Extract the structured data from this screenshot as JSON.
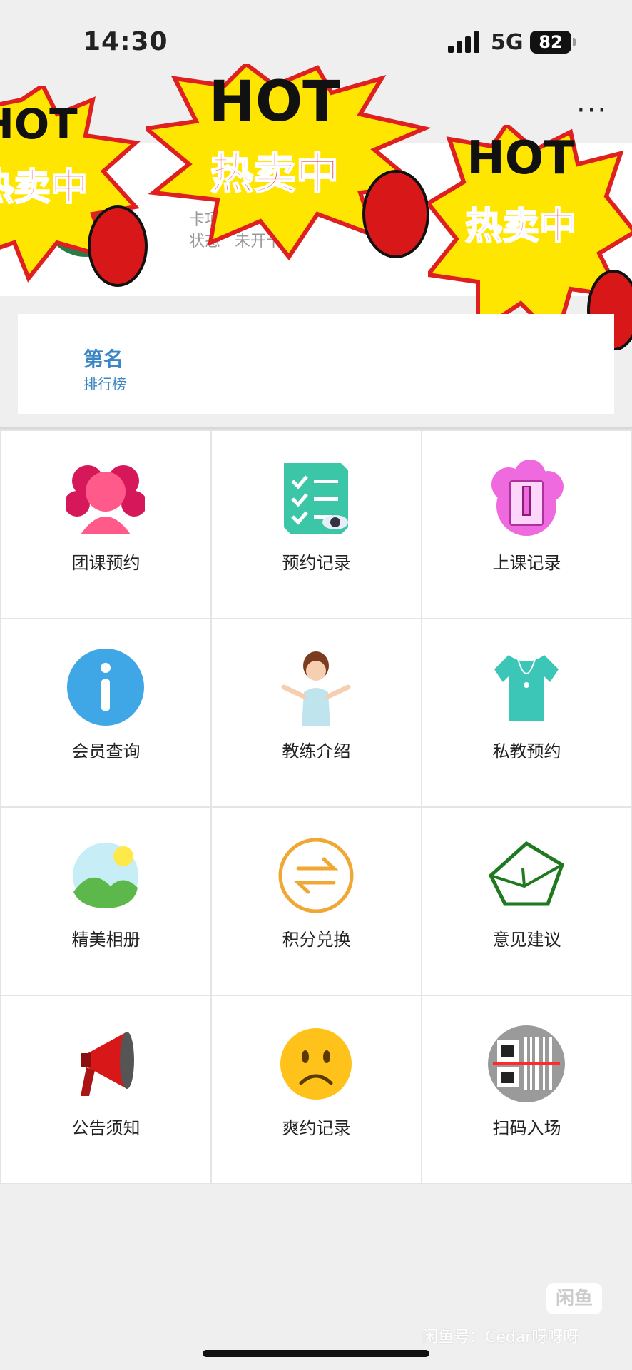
{
  "status_bar": {
    "time": "14:30",
    "network": "5G",
    "battery": "82"
  },
  "card": {
    "row1": "卡项",
    "status_label": "状态",
    "status_value": "未开卡"
  },
  "stickers": {
    "hot": "HOT",
    "sub": "热卖中"
  },
  "rank": {
    "title": "第名",
    "subtitle": "排行榜"
  },
  "grid": [
    {
      "label": "团课预约",
      "icon": "group-class-icon"
    },
    {
      "label": "预约记录",
      "icon": "booking-record-icon"
    },
    {
      "label": "上课记录",
      "icon": "class-record-icon"
    },
    {
      "label": "会员查询",
      "icon": "info-icon"
    },
    {
      "label": "教练介绍",
      "icon": "coach-icon"
    },
    {
      "label": "私教预约",
      "icon": "shirt-icon"
    },
    {
      "label": "精美相册",
      "icon": "album-icon"
    },
    {
      "label": "积分兑换",
      "icon": "exchange-icon"
    },
    {
      "label": "意见建议",
      "icon": "envelope-icon"
    },
    {
      "label": "公告须知",
      "icon": "megaphone-icon"
    },
    {
      "label": "爽约记录",
      "icon": "sad-face-icon"
    },
    {
      "label": "扫码入场",
      "icon": "qr-scan-icon"
    }
  ],
  "watermark": {
    "logo": "闲鱼",
    "text": "闲鱼号：Cedar呀呀呀"
  }
}
